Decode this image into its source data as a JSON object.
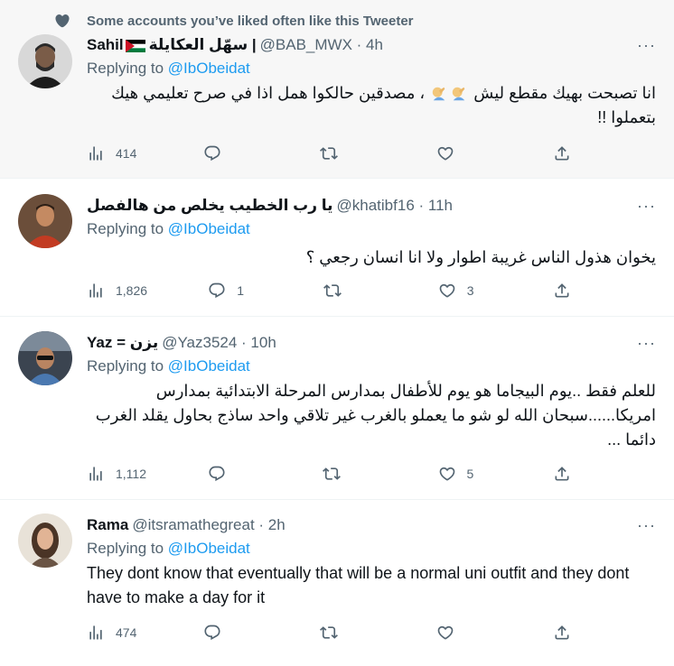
{
  "social_context": "Some accounts you’ve liked often like this Tweeter",
  "replying_prefix": "Replying to",
  "replying_handle": "@IbObeidat",
  "more_glyph": "···",
  "tweets": [
    {
      "name_prefix": "Sahil",
      "name_ar": "سهّل العكايلة |",
      "handle_time": "@BAB_MWX · 4h",
      "text_part1": "انا تصبحت بهيك مقطع ليش",
      "text_part2": "، مصدقين حالكوا همل اذا في صرح تعليمي هيك بتعملوا !!",
      "views": "414",
      "replies": "",
      "likes": ""
    },
    {
      "name": "يا رب الخطيب يخلص من هالفصل",
      "handle_time": "@khatibf16 · 11h",
      "text": "يخوان هذول الناس غريبة اطوار ولا انا انسان رجعي ؟",
      "views": "1,826",
      "replies": "1",
      "likes": "3"
    },
    {
      "name": "Yaz = يزن",
      "handle_time": "@Yaz3524 · 10h",
      "text": "للعلم فقط ..يوم البيجاما هو يوم للأطفال بمدارس المرحلة الابتدائية بمدارس امريكا......سبحان الله لو شو ما يعملو بالغرب غير تلاقي واحد ساذج بحاول يقلد الغرب دائما ...",
      "views": "1,112",
      "replies": "",
      "likes": "5"
    },
    {
      "name": "Rama",
      "handle_time": "@itsramathegreat · 2h",
      "text": "They dont know that eventually that will be a normal uni outfit and they dont have to make a day for it",
      "views": "474",
      "replies": "",
      "likes": ""
    }
  ],
  "icons": [
    "heart-icon",
    "views-icon",
    "reply-icon",
    "retweet-icon",
    "like-icon",
    "share-icon",
    "more-icon"
  ],
  "colors": {
    "link": "#1d9bf0",
    "muted": "#536471",
    "text": "#0f1419",
    "liked_bg": "#f7f7f7"
  }
}
